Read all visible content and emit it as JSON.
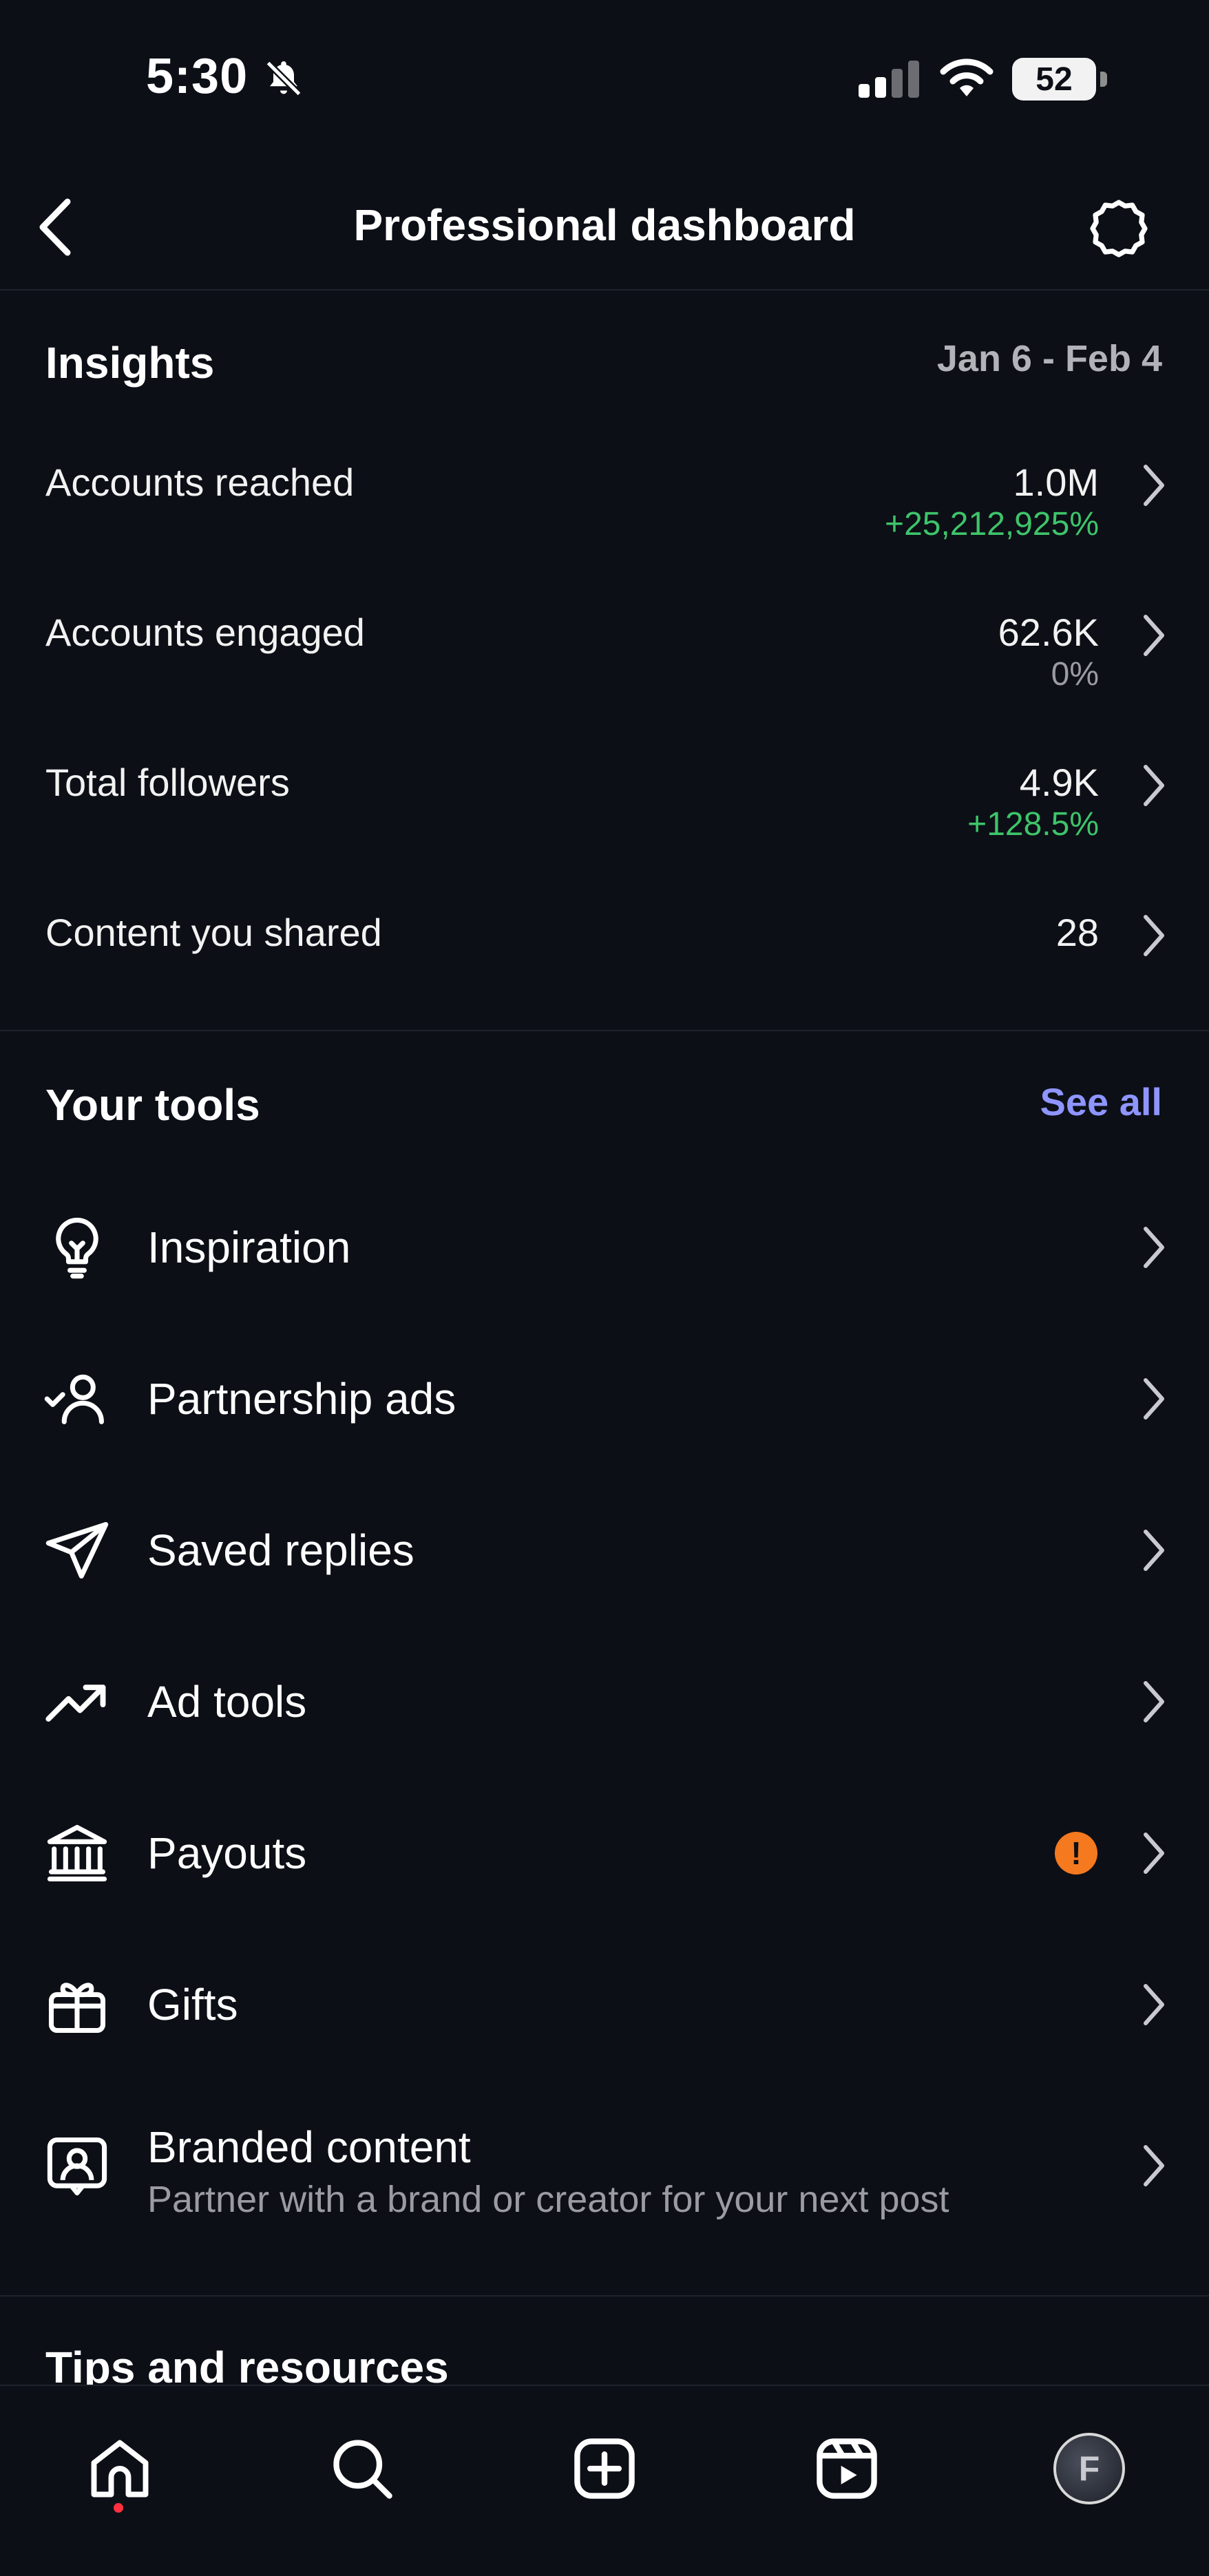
{
  "status_bar": {
    "time": "5:30",
    "battery": "52"
  },
  "header": {
    "title": "Professional dashboard"
  },
  "insights": {
    "heading": "Insights",
    "date_range": "Jan 6 - Feb 4",
    "rows": [
      {
        "label": "Accounts reached",
        "value": "1.0M",
        "change": "+25,212,925%"
      },
      {
        "label": "Accounts engaged",
        "value": "62.6K",
        "change": "0%"
      },
      {
        "label": "Total followers",
        "value": "4.9K",
        "change": "+128.5%"
      },
      {
        "label": "Content you shared",
        "value": "28"
      }
    ]
  },
  "tools": {
    "heading": "Your tools",
    "see_all": "See all",
    "items": [
      {
        "label": "Inspiration",
        "icon": "lightbulb-icon"
      },
      {
        "label": "Partnership ads",
        "icon": "partnership-icon"
      },
      {
        "label": "Saved replies",
        "icon": "paper-plane-icon"
      },
      {
        "label": "Ad tools",
        "icon": "trend-up-icon"
      },
      {
        "label": "Payouts",
        "icon": "bank-icon",
        "alert": "!"
      },
      {
        "label": "Gifts",
        "icon": "gift-icon"
      },
      {
        "label": "Branded content",
        "sublabel": "Partner with a brand or creator for your next post",
        "icon": "branded-content-icon"
      }
    ]
  },
  "tips": {
    "heading": "Tips and resources"
  },
  "bottom_nav": {
    "items": [
      "home-icon",
      "search-icon",
      "create-icon",
      "reels-icon",
      "profile-avatar"
    ],
    "avatar_letter": "F"
  },
  "colors": {
    "background": "#0c0f16",
    "positive": "#3ec46a",
    "link": "#8e95ff",
    "alert": "#f5791f",
    "notification_dot": "#ff3040"
  }
}
